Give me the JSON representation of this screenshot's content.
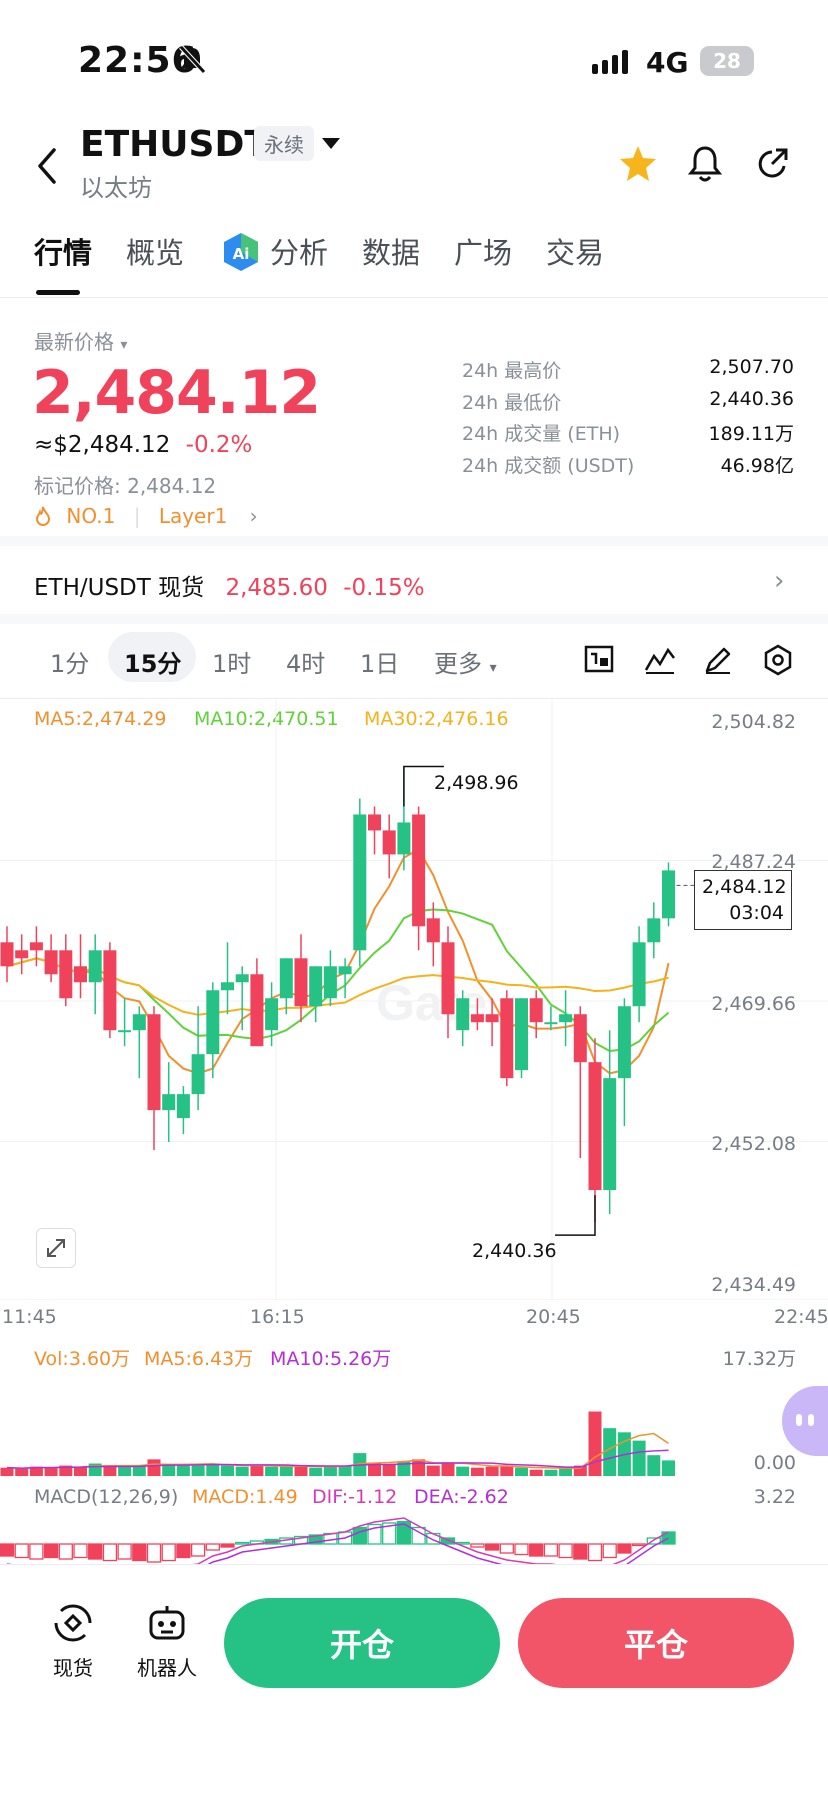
{
  "status_bar": {
    "time": "22:56",
    "network": "4G",
    "battery": "28"
  },
  "header": {
    "symbol": "ETHUSDT",
    "badge": "永续",
    "name": "以太坊"
  },
  "tabs": [
    "行情",
    "概览",
    "分析",
    "数据",
    "广场",
    "交易"
  ],
  "price": {
    "label": "最新价格",
    "last": "2,484.12",
    "usd": "≈$2,484.12",
    "change": "-0.2%",
    "mark": "标记价格: 2,484.12",
    "tag1": "NO.1",
    "tag2": "Layer1"
  },
  "stats": [
    {
      "k": "24h 最高价",
      "v": "2,507.70"
    },
    {
      "k": "24h 最低价",
      "v": "2,440.36"
    },
    {
      "k": "24h 成交量 (ETH)",
      "v": "189.11万"
    },
    {
      "k": "24h 成交额 (USDT)",
      "v": "46.98亿"
    }
  ],
  "spot": {
    "label": "ETH/USDT 现货",
    "price": "2,485.60",
    "change": "-0.15%"
  },
  "timeframes": [
    "1分",
    "15分",
    "1时",
    "4时",
    "1日",
    "更多"
  ],
  "ma": {
    "ma5": "MA5:2,474.29",
    "ma10": "MA10:2,470.51",
    "ma30": "MA30:2,476.16"
  },
  "y_axis": [
    "2,504.82",
    "2,487.24",
    "2,469.66",
    "2,452.08",
    "2,434.49"
  ],
  "x_axis": [
    "11:45",
    "16:15",
    "20:45",
    "22:45"
  ],
  "annotations": {
    "high": "2,498.96",
    "low": "2,440.36",
    "current_price": "2,484.12",
    "countdown": "03:04"
  },
  "watermark": "Gate",
  "volume": {
    "vol": "Vol:3.60万",
    "ma5": "MA5:6.43万",
    "ma10": "MA10:5.26万",
    "max": "17.32万",
    "min": "0.00"
  },
  "macd": {
    "label": "MACD(12,26,9)",
    "macd": "MACD:1.49",
    "dif": "DIF:-1.12",
    "dea": "DEA:-2.62",
    "max": "3.22"
  },
  "bottom": {
    "spot_label": "现货",
    "bot_label": "机器人",
    "open": "开仓",
    "close": "平仓"
  },
  "colors": {
    "up": "#26c285",
    "down": "#f0425a",
    "ma5": "#f2902f",
    "ma10": "#5fd33a",
    "ma30": "#f5b21c",
    "purple": "#b42fd6"
  }
}
